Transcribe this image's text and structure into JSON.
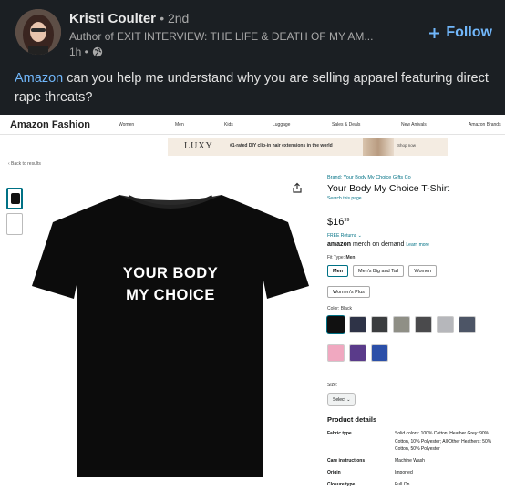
{
  "post": {
    "author_name": "Kristi Coulter",
    "author_degree": "• 2nd",
    "author_title": "Author of EXIT INTERVIEW: THE LIFE & DEATH OF MY AM...",
    "time": "1h •",
    "follow_label": "Follow",
    "mention": "Amazon",
    "text": " can you help me understand why you are selling apparel featuring direct rape threats?",
    "colors": {
      "background": "#1b1f23",
      "link": "#71b7fb",
      "text": "#e0e0e0"
    }
  },
  "amazon": {
    "brand": "Amazon Fashion",
    "nav_links": [
      "Women",
      "Men",
      "Kids",
      "Luggage",
      "Sales & Deals",
      "New Arrivals",
      "Amazon Brands"
    ],
    "ad": {
      "brand": "LUXY",
      "text": "#1-rated DIY clip-in hair extensions in the world",
      "cta": "Shop now"
    },
    "back_link": "‹ Back to results",
    "product": {
      "shirt_line1": "YOUR BODY",
      "shirt_line2": "MY CHOICE",
      "brand_link": "Brand: Your Body My Choice Gifts Co",
      "title": "Your Body My Choice T-Shirt",
      "search_page": "Search this page",
      "price_dollars": "$16",
      "price_cents": "99",
      "returns": "FREE Returns ⌄",
      "mod_logo": "amazon",
      "mod_text": " merch on demand",
      "learn_more": "Learn more",
      "fit_type_label": "Fit Type:",
      "fit_type_value": "Men",
      "fit_options": [
        "Men",
        "Men's Big and Tall",
        "Women",
        "Women's Plus"
      ],
      "color_label": "Color:",
      "color_value": "Black",
      "swatches": [
        "#111111",
        "#2e3347",
        "#3b3d3f",
        "#8f8f86",
        "#4a4a4c",
        "#b6b7bb",
        "#4d5566",
        "#f0a8c0",
        "#5a3b8a",
        "#2b4fa8"
      ],
      "size_label": "Size:",
      "size_select": "Select ⌄",
      "details_heading": "Product details",
      "details": [
        {
          "key": "Fabric type",
          "value": "Solid colors: 100% Cotton; Heather Grey: 90% Cotton, 10% Polyester; All Other Heathers: 50% Cotton, 50% Polyester"
        },
        {
          "key": "Care instructions",
          "value": "Machine Wash"
        },
        {
          "key": "Origin",
          "value": "Imported"
        },
        {
          "key": "Closure type",
          "value": "Pull On"
        }
      ]
    }
  }
}
